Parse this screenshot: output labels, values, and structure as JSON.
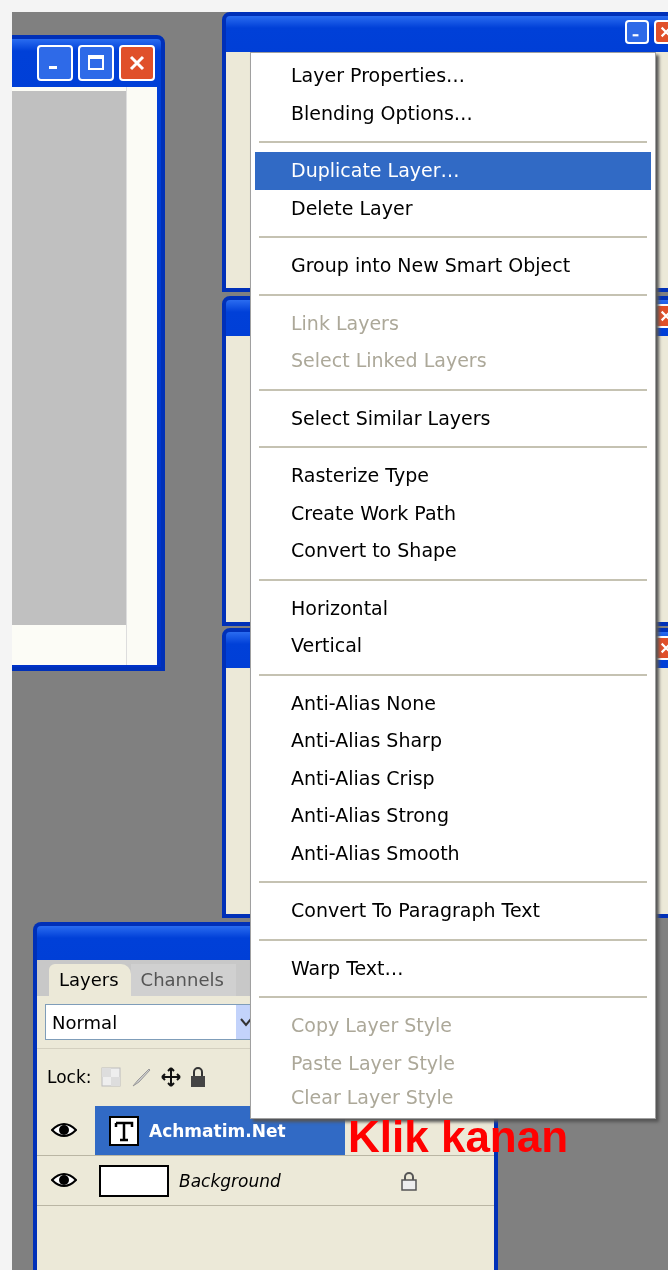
{
  "context_menu": {
    "items": [
      {
        "kind": "item",
        "label": "Layer Properties…",
        "disabled": false,
        "selected": false
      },
      {
        "kind": "item",
        "label": "Blending Options…",
        "disabled": false,
        "selected": false
      },
      {
        "kind": "separator"
      },
      {
        "kind": "item",
        "label": "Duplicate Layer…",
        "disabled": false,
        "selected": true
      },
      {
        "kind": "item",
        "label": "Delete Layer",
        "disabled": false,
        "selected": false
      },
      {
        "kind": "separator"
      },
      {
        "kind": "item",
        "label": "Group into New Smart Object",
        "disabled": false,
        "selected": false
      },
      {
        "kind": "separator"
      },
      {
        "kind": "item",
        "label": "Link Layers",
        "disabled": true,
        "selected": false
      },
      {
        "kind": "item",
        "label": "Select Linked Layers",
        "disabled": true,
        "selected": false
      },
      {
        "kind": "separator"
      },
      {
        "kind": "item",
        "label": "Select Similar Layers",
        "disabled": false,
        "selected": false
      },
      {
        "kind": "separator"
      },
      {
        "kind": "item",
        "label": "Rasterize Type",
        "disabled": false,
        "selected": false
      },
      {
        "kind": "item",
        "label": "Create Work Path",
        "disabled": false,
        "selected": false
      },
      {
        "kind": "item",
        "label": "Convert to Shape",
        "disabled": false,
        "selected": false
      },
      {
        "kind": "separator"
      },
      {
        "kind": "item",
        "label": "Horizontal",
        "disabled": false,
        "selected": false
      },
      {
        "kind": "item",
        "label": "Vertical",
        "disabled": false,
        "selected": false
      },
      {
        "kind": "separator"
      },
      {
        "kind": "item",
        "label": "Anti-Alias None",
        "disabled": false,
        "selected": false
      },
      {
        "kind": "item",
        "label": "Anti-Alias Sharp",
        "disabled": false,
        "selected": false
      },
      {
        "kind": "item",
        "label": "Anti-Alias Crisp",
        "disabled": false,
        "selected": false
      },
      {
        "kind": "item",
        "label": "Anti-Alias Strong",
        "disabled": false,
        "selected": false
      },
      {
        "kind": "item",
        "label": "Anti-Alias Smooth",
        "disabled": false,
        "selected": false
      },
      {
        "kind": "separator"
      },
      {
        "kind": "item",
        "label": "Convert To Paragraph Text",
        "disabled": false,
        "selected": false
      },
      {
        "kind": "separator"
      },
      {
        "kind": "item",
        "label": "Warp Text…",
        "disabled": false,
        "selected": false
      },
      {
        "kind": "separator"
      },
      {
        "kind": "item",
        "label": "Copy Layer Style",
        "disabled": true,
        "selected": false
      },
      {
        "kind": "item",
        "label": "Paste Layer Style",
        "disabled": true,
        "selected": false
      },
      {
        "kind": "item",
        "label": "Clear Layer Style",
        "disabled": true,
        "selected": false
      }
    ]
  },
  "layers_panel": {
    "tabs": [
      {
        "label": "Layers",
        "selected": true
      },
      {
        "label": "Channels",
        "selected": false
      }
    ],
    "blend_mode": "Normal",
    "lock_label": "Lock:",
    "layers": [
      {
        "kind": "text",
        "name": "Achmatim.Net",
        "selected": true,
        "locked": false
      },
      {
        "kind": "background",
        "name": "Background",
        "selected": false,
        "locked": true
      }
    ]
  },
  "annotation": {
    "text": "Klik kanan"
  }
}
